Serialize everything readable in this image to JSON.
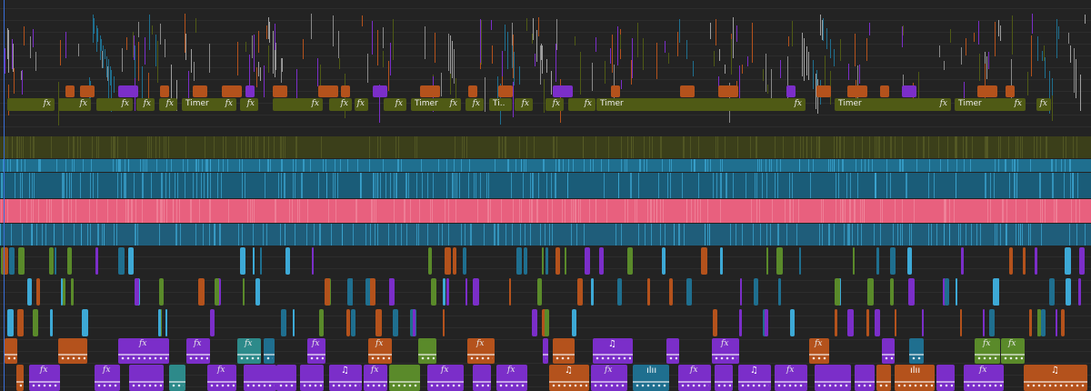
{
  "timeline": {
    "colors": {
      "background": "#232323",
      "olive": "#4f5a15",
      "olive_dark": "#3b3f1a",
      "teal": "#1f6f8f",
      "teal_light": "#3da9d6",
      "pink": "#e8607e",
      "orange": "#b4521c",
      "purple": "#7b2ec9",
      "green": "#5a8a2a",
      "cyan_clip": "#2d8a8a",
      "playhead": "#3a6fd8"
    },
    "fx_label": "fx",
    "title_clip_label": "Timer",
    "title_clip_label_truncated": "Ti..",
    "music_icon": "♫",
    "audio_icon": "ılıı"
  }
}
